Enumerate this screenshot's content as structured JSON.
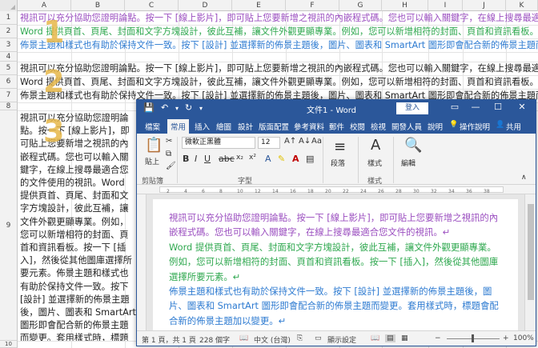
{
  "excel": {
    "columns": [
      "A",
      "B",
      "C",
      "D",
      "E",
      "F",
      "G",
      "H",
      "I",
      "J",
      "K"
    ],
    "rows": [
      "1",
      "2",
      "3",
      "4",
      "5",
      "6",
      "7",
      "8",
      "9",
      "10",
      "11",
      "12",
      "13",
      "14",
      "15",
      "16",
      "17",
      "18",
      "19"
    ],
    "step_numbers": [
      "1",
      "2",
      "3"
    ],
    "row1": "視訊可以充分協助您證明論點。按一下 [線上影片]，即可貼上您要新增之視訊的內嵌程式碼。您也可以輸入關鍵字，在線上搜尋最適合您文件的視訊。",
    "row2": "Word 提供頁首、頁尾、封面和文字方塊設計，彼此互補，讓文件外觀更顯專業。例如，您可以新增相符的封面、頁首和資訊看板。按一下 [插入]，然後從其他圖庫選擇所要元素。",
    "row3": "佈景主題和樣式也有助於保持文件一致。按下 [設計] 並選擇新的佈景主題後，圖片、圖表和 SmartArt 圖形即會配合新的佈景主題而變更。",
    "row5": "視訊可以充分協助您證明論點。按一下 [線上影片]，即可貼上您要新增之視訊的內嵌程式碼。您也可以輸入關鍵字，在線上搜尋最適合您文件的視訊。",
    "row6": "Word 提供頁首、頁尾、封面和文字方塊設計，彼此互補，讓文件外觀更顯專業。例如，您可以新增相符的封面、頁首和資訊看板。按一下 [插入]，然後從其他圖庫選擇所要元素。",
    "row7": "佈景主題和樣式也有助於保持文件一致。按下 [設計] 並選擇新的佈景主題後，圖片、圖表和 SmartArt 圖形即會配合新的佈景主題而變更。",
    "wrapped_cell": "視訊可以充分協助您證明論點。按一下 [線上影片]，即可貼上您要新增之視訊的內嵌程式碼。您也可以輸入關鍵字，在線上搜尋最適合您的文件使用的視訊。Word 提供頁首、頁尾、封面和文字方塊設計，彼此互補，讓文件外觀更顯專業。例如，您可以新增相符的封面、頁首和資訊看板。按一下 [插入]，然後從其他圖庫選擇所要元素。佈景主題和樣式也有助於保持文件一致。按下 [設計] 並選擇新的佈景主題後，圖片、圖表和 SmartArt 圖形即會配合新的佈景主題而變更。套用樣式時，標題會配合新的佈景主題加以變更。"
  },
  "word": {
    "window_title": "文件1 - Word",
    "login_label": "登入",
    "qat_icons": [
      "save-icon",
      "undo-icon",
      "redo-icon"
    ],
    "tabs": [
      "檔案",
      "常用",
      "插入",
      "繪圖",
      "設計",
      "版面配置",
      "參考資料",
      "郵件",
      "校閱",
      "檢視",
      "開發人員",
      "說明"
    ],
    "active_tab": "常用",
    "tell_me": "操作說明",
    "share": "共用",
    "ribbon": {
      "paste_label": "貼上",
      "font_name": "微軟正黑體",
      "font_size": "12",
      "paragraph_label": "段落",
      "styles_label": "樣式",
      "editing_label": "編輯",
      "groups": [
        "剪貼簿",
        "字型",
        "樣式"
      ]
    },
    "ruler_ticks": [
      "2",
      "4",
      "6",
      "8",
      "10",
      "12",
      "14",
      "16",
      "18",
      "20",
      "22",
      "24",
      "26",
      "28",
      "30",
      "32",
      "34",
      "36",
      "38"
    ],
    "paragraphs": [
      {
        "text": "視訊可以充分協助您證明論點。按一下 [線上影片]，即可貼上您要新增之視訊的內嵌程式碼。您也可以輸入關鍵字，在線上搜尋最適合您文件的視訊。↵",
        "color": "#9b4fc0"
      },
      {
        "text": "Word 提供頁首、頁尾、封面和文字方塊設計，彼此互補，讓文件外觀更顯專業。例如，您可以新增相符的封面、頁首和資訊看板。按一下 [插入]，然後從其他圖庫選擇所要元素。↵",
        "color": "#2fa84f"
      },
      {
        "text": "佈景主題和樣式也有助於保持文件一致。按下 [設計] 並選擇新的佈景主題後，圖片、圖表和 SmartArt 圖形即會配合新的佈景主題而變更。套用樣式時，標題會配合新的佈景主題加以變更。↵",
        "color": "#2e7bd1"
      }
    ],
    "status": {
      "page": "第 1 頁，共 1 頁",
      "words": "228 個字",
      "language": "中文 (台灣)",
      "display_settings": "顯示設定",
      "zoom": "100%"
    }
  }
}
